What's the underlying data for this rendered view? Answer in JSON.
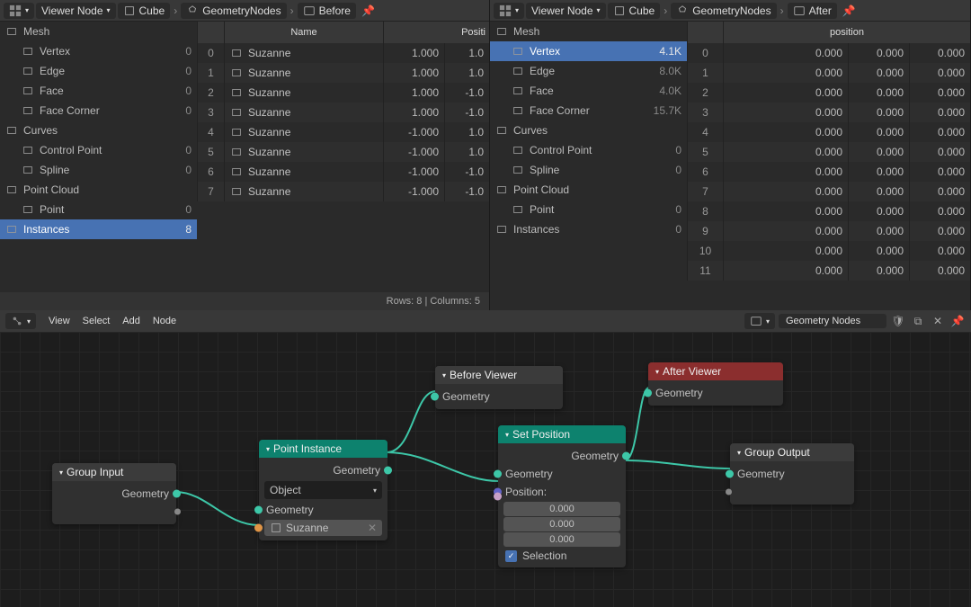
{
  "app": "Blender",
  "panels": {
    "left": {
      "header": {
        "viewer": "Viewer Node",
        "object": "Cube",
        "nodegroup": "GeometryNodes",
        "viewerNode": "Before"
      },
      "tree": [
        {
          "label": "Mesh",
          "count": "",
          "cat": true
        },
        {
          "label": "Vertex",
          "count": "0"
        },
        {
          "label": "Edge",
          "count": "0"
        },
        {
          "label": "Face",
          "count": "0"
        },
        {
          "label": "Face Corner",
          "count": "0"
        },
        {
          "label": "Curves",
          "count": "",
          "cat": true
        },
        {
          "label": "Control Point",
          "count": "0"
        },
        {
          "label": "Spline",
          "count": "0"
        },
        {
          "label": "Point Cloud",
          "count": "",
          "cat": true
        },
        {
          "label": "Point",
          "count": "0"
        },
        {
          "label": "Instances",
          "count": "8",
          "cat": true,
          "selected": true
        }
      ],
      "columns": [
        "",
        "Name",
        "Positi"
      ],
      "rows": [
        {
          "idx": "0",
          "name": "Suzanne",
          "v1": "1.000",
          "v2": "1.0"
        },
        {
          "idx": "1",
          "name": "Suzanne",
          "v1": "1.000",
          "v2": "1.0"
        },
        {
          "idx": "2",
          "name": "Suzanne",
          "v1": "1.000",
          "v2": "-1.0"
        },
        {
          "idx": "3",
          "name": "Suzanne",
          "v1": "1.000",
          "v2": "-1.0"
        },
        {
          "idx": "4",
          "name": "Suzanne",
          "v1": "-1.000",
          "v2": "1.0"
        },
        {
          "idx": "5",
          "name": "Suzanne",
          "v1": "-1.000",
          "v2": "1.0"
        },
        {
          "idx": "6",
          "name": "Suzanne",
          "v1": "-1.000",
          "v2": "-1.0"
        },
        {
          "idx": "7",
          "name": "Suzanne",
          "v1": "-1.000",
          "v2": "-1.0"
        }
      ],
      "footer": "Rows: 8   |   Columns: 5"
    },
    "right": {
      "header": {
        "viewer": "Viewer Node",
        "object": "Cube",
        "nodegroup": "GeometryNodes",
        "viewerNode": "After"
      },
      "tree": [
        {
          "label": "Mesh",
          "count": "",
          "cat": true
        },
        {
          "label": "Vertex",
          "count": "4.1K",
          "selected": true
        },
        {
          "label": "Edge",
          "count": "8.0K"
        },
        {
          "label": "Face",
          "count": "4.0K"
        },
        {
          "label": "Face Corner",
          "count": "15.7K"
        },
        {
          "label": "Curves",
          "count": "",
          "cat": true
        },
        {
          "label": "Control Point",
          "count": "0"
        },
        {
          "label": "Spline",
          "count": "0"
        },
        {
          "label": "Point Cloud",
          "count": "",
          "cat": true
        },
        {
          "label": "Point",
          "count": "0"
        },
        {
          "label": "Instances",
          "count": "0",
          "cat": true
        }
      ],
      "columns": [
        "",
        "position"
      ],
      "rows": [
        {
          "idx": "0",
          "v1": "0.000",
          "v2": "0.000",
          "v3": "0.000"
        },
        {
          "idx": "1",
          "v1": "0.000",
          "v2": "0.000",
          "v3": "0.000"
        },
        {
          "idx": "2",
          "v1": "0.000",
          "v2": "0.000",
          "v3": "0.000"
        },
        {
          "idx": "3",
          "v1": "0.000",
          "v2": "0.000",
          "v3": "0.000"
        },
        {
          "idx": "4",
          "v1": "0.000",
          "v2": "0.000",
          "v3": "0.000"
        },
        {
          "idx": "5",
          "v1": "0.000",
          "v2": "0.000",
          "v3": "0.000"
        },
        {
          "idx": "6",
          "v1": "0.000",
          "v2": "0.000",
          "v3": "0.000"
        },
        {
          "idx": "7",
          "v1": "0.000",
          "v2": "0.000",
          "v3": "0.000"
        },
        {
          "idx": "8",
          "v1": "0.000",
          "v2": "0.000",
          "v3": "0.000"
        },
        {
          "idx": "9",
          "v1": "0.000",
          "v2": "0.000",
          "v3": "0.000"
        },
        {
          "idx": "10",
          "v1": "0.000",
          "v2": "0.000",
          "v3": "0.000"
        },
        {
          "idx": "11",
          "v1": "0.000",
          "v2": "0.000",
          "v3": "0.000"
        }
      ]
    }
  },
  "nodeEditor": {
    "menus": [
      "View",
      "Select",
      "Add",
      "Node"
    ],
    "activeGroup": "Geometry Nodes",
    "nodes": {
      "groupInput": {
        "title": "Group Input",
        "out": "Geometry"
      },
      "pointInstance": {
        "title": "Point Instance",
        "out": "Geometry",
        "dropType": "Object",
        "in": "Geometry",
        "objField": "Suzanne"
      },
      "beforeViewer": {
        "title": "Before Viewer",
        "in": "Geometry"
      },
      "setPosition": {
        "title": "Set Position",
        "out": "Geometry",
        "in": "Geometry",
        "posLabel": "Position:",
        "px": "0.000",
        "py": "0.000",
        "pz": "0.000",
        "sel": "Selection"
      },
      "afterViewer": {
        "title": "After Viewer",
        "in": "Geometry"
      },
      "groupOutput": {
        "title": "Group Output",
        "in": "Geometry"
      }
    }
  }
}
